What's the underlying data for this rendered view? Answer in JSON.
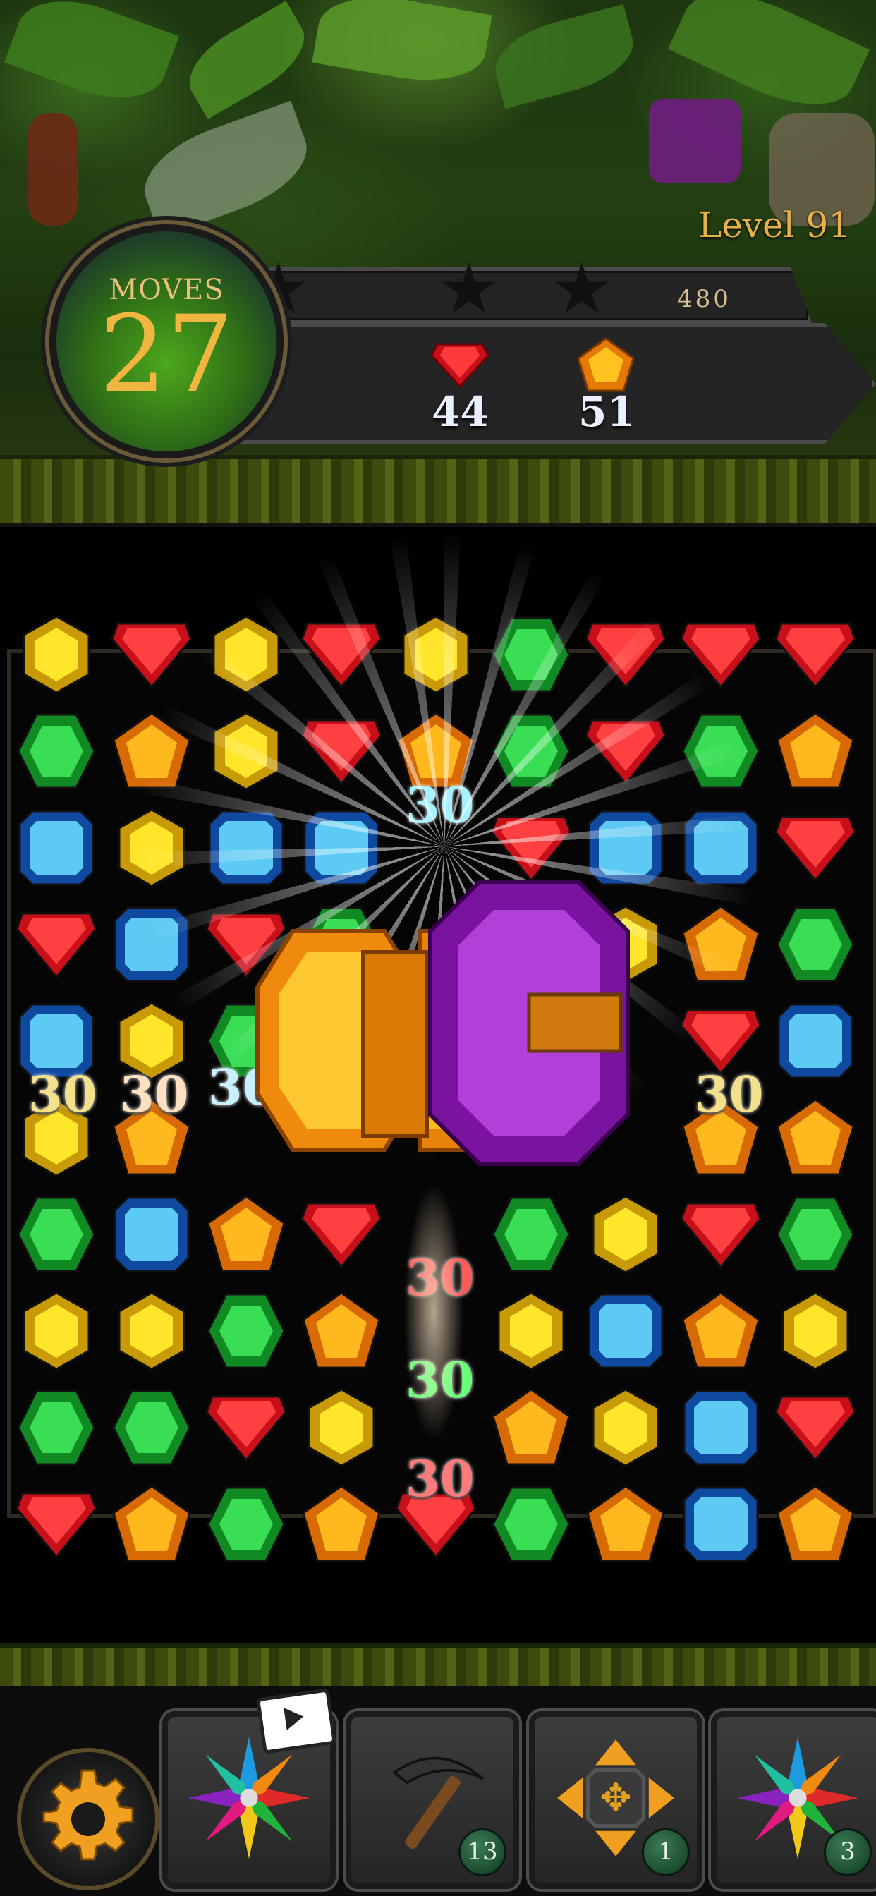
{
  "hud": {
    "moves_label": "MOVES",
    "moves_value": "27",
    "level_text": "Level 91",
    "score": "480",
    "stars_earned": 0,
    "stars_total": 3,
    "goals": [
      {
        "icon": "red-gem-icon",
        "count": "44",
        "color": "#d01a1a"
      },
      {
        "icon": "orange-gem-icon",
        "count": "51",
        "color": "#f29a12"
      }
    ]
  },
  "popups": [
    "30",
    "30",
    "30",
    "30",
    "30",
    "30",
    "30",
    "30"
  ],
  "boosters": [
    {
      "icon": "star-flower-icon",
      "count": "",
      "video": true
    },
    {
      "icon": "pickaxe-icon",
      "count": "13"
    },
    {
      "icon": "move-arrows-icon",
      "count": "1"
    },
    {
      "icon": "star-flower-icon",
      "count": "3"
    }
  ],
  "colors": {
    "red": "#d41a24",
    "green": "#1fb33a",
    "blue": "#2e9bd8",
    "yellow": "#f2d21a",
    "orange": "#f28a12",
    "purple": "#8a1fb0",
    "gold_text": "#e7b04a"
  },
  "board": {
    "rows": [
      [
        "yellow",
        "red",
        "yellow",
        "red",
        "yellow",
        "green",
        "red",
        "red",
        "red"
      ],
      [
        "green",
        "orange",
        "yellow",
        "red",
        "orange",
        "green",
        "red",
        "green",
        "orange"
      ],
      [
        "blue",
        "yellow",
        "blue",
        "blue",
        "",
        "red",
        "blue",
        "blue",
        "red"
      ],
      [
        "red",
        "blue",
        "red",
        "green",
        "",
        "",
        "yellow",
        "orange",
        "green"
      ],
      [
        "blue",
        "yellow",
        "green",
        "",
        "",
        "",
        "",
        "red",
        "blue"
      ],
      [
        "yellow",
        "orange",
        "",
        "",
        "",
        "",
        "",
        "orange",
        "orange"
      ],
      [
        "green",
        "blue",
        "orange",
        "red",
        "",
        "green",
        "yellow",
        "red",
        "green"
      ],
      [
        "yellow",
        "yellow",
        "green",
        "orange",
        "",
        "yellow",
        "blue",
        "orange",
        "yellow"
      ],
      [
        "green",
        "green",
        "red",
        "yellow",
        "",
        "orange",
        "yellow",
        "blue",
        "red"
      ],
      [
        "red",
        "orange",
        "green",
        "orange",
        "red",
        "green",
        "orange",
        "blue",
        "orange"
      ]
    ]
  }
}
